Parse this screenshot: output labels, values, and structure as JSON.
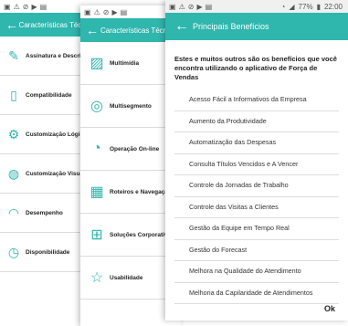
{
  "screen1": {
    "title": "Características Técnicas",
    "items": [
      {
        "label": "Assinatura e Descrição",
        "icon": "pen-icon"
      },
      {
        "label": "Compatibilidade",
        "icon": "tablet-icon"
      },
      {
        "label": "Customização Lógica",
        "icon": "gear-icon"
      },
      {
        "label": "Customização Visual",
        "icon": "palette-icon"
      },
      {
        "label": "Desempenho",
        "icon": "speedometer-icon"
      },
      {
        "label": "Disponibilidade",
        "icon": "clock-icon"
      }
    ]
  },
  "screen2": {
    "title": "Características Técnicas",
    "items": [
      {
        "label": "Multimídia",
        "icon": "image-icon"
      },
      {
        "label": "Multisegmento",
        "icon": "globe-icon"
      },
      {
        "label": "Operação On-line",
        "icon": "wifi-icon"
      },
      {
        "label": "Roteiros e Navegação",
        "icon": "map-icon"
      },
      {
        "label": "Soluções Corporativas",
        "icon": "org-chart-icon"
      },
      {
        "label": "Usabilidade",
        "icon": "star-icon"
      }
    ]
  },
  "screen3": {
    "status": {
      "battery": "77%",
      "time": "22:00"
    },
    "title": "Principais Benefícios",
    "intro": "Estes e muitos outros são os benefícios que você encontra utilizando o aplicativo de Força de Vendas",
    "benefits": [
      "Acesso Fácil a Informativos da Empresa",
      "Aumento da Produtividade",
      "Automatização das Despesas",
      "Consulta Títulos Vencidos e A Vencer",
      "Controle da Jornadas de Trabalho",
      "Controle das Visitas a Clientes",
      "Gestão da Equipe em Tempo Real",
      "Gestão do Forecast",
      "Melhora na Qualidade do Atendimento",
      "Melhoria da Capilaridade de Atendimentos"
    ],
    "ok_label": "Ok"
  },
  "colors": {
    "accent": "#2fb6ad"
  }
}
